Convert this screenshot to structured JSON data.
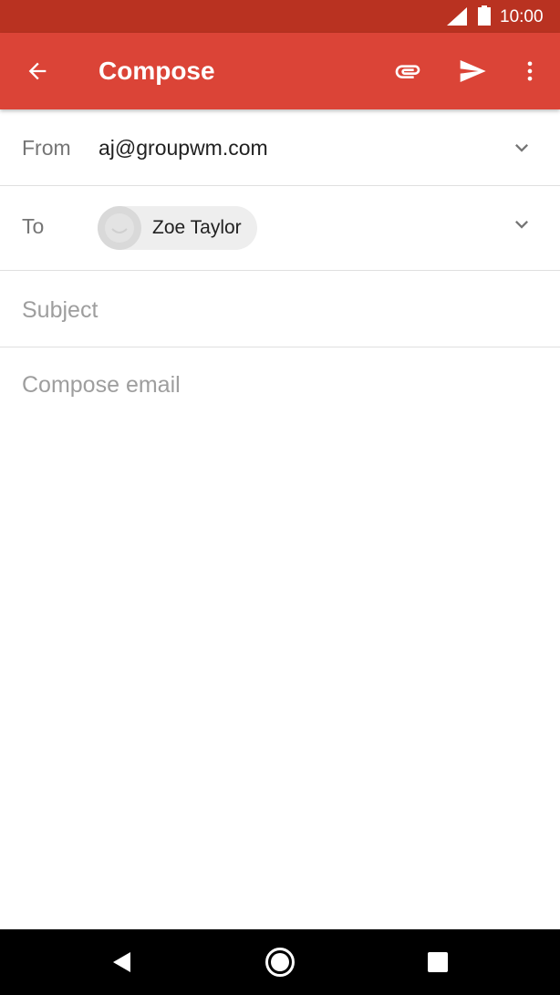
{
  "status_bar": {
    "time": "10:00",
    "icons": [
      "signal-icon",
      "battery-icon"
    ]
  },
  "app_bar": {
    "title": "Compose",
    "icons": {
      "back": "arrow-back-icon",
      "attach": "paperclip-icon",
      "send": "send-icon",
      "more": "more-vert-icon"
    }
  },
  "form": {
    "from_label": "From",
    "from_value": "aj@groupwm.com",
    "to_label": "To",
    "recipients": [
      {
        "name": "Zoe Taylor"
      }
    ],
    "subject_placeholder": "Subject",
    "body_placeholder": "Compose email"
  },
  "nav_bar": {
    "icons": [
      "nav-back-icon",
      "nav-home-icon",
      "nav-recents-icon"
    ]
  },
  "colors": {
    "status_bar": "#b93221",
    "app_bar": "#db4437",
    "chip_bg": "#eeeeee",
    "divider": "#e0e0e0"
  }
}
